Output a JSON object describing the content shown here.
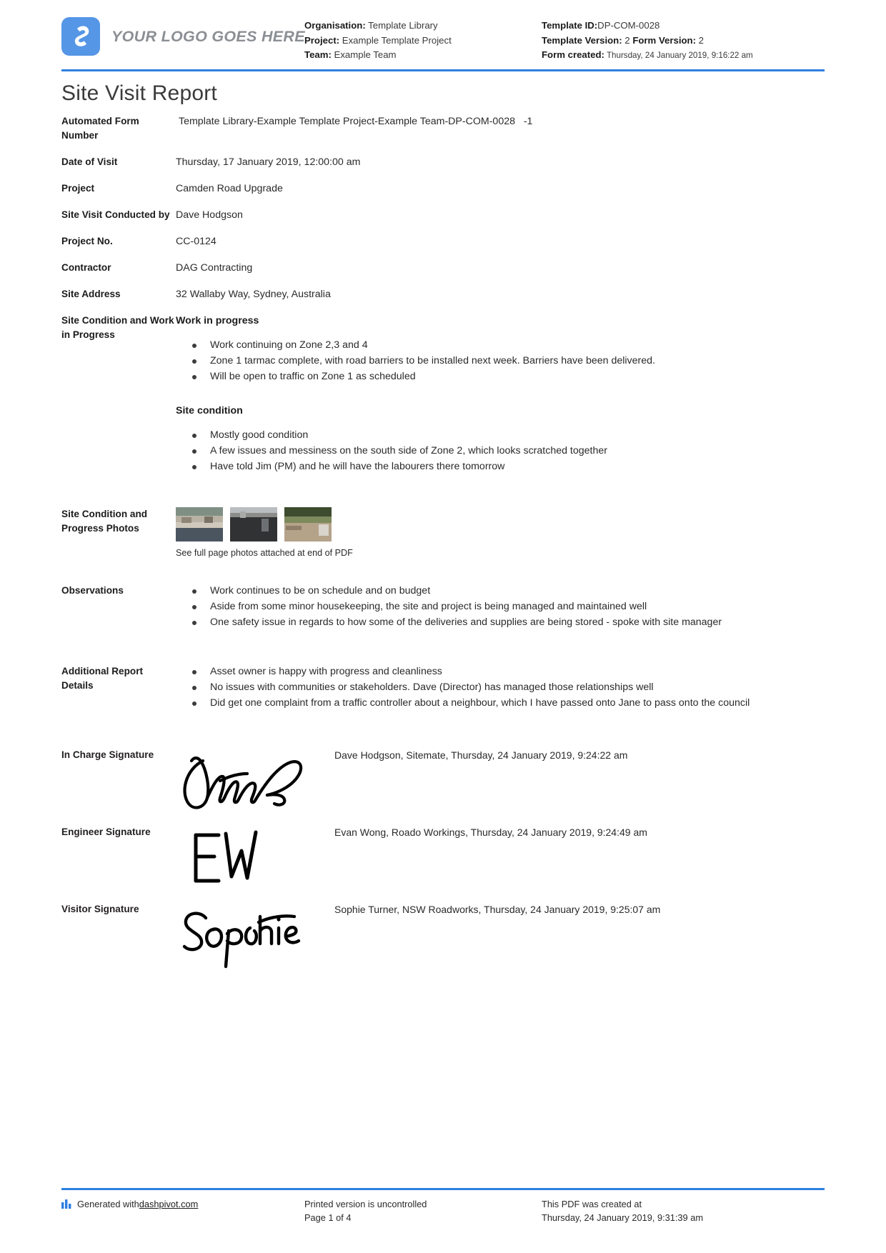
{
  "header": {
    "logo_text": "YOUR LOGO GOES HERE",
    "left": {
      "organisation_label": "Organisation:",
      "organisation_value": "Template Library",
      "project_label": "Project:",
      "project_value": "Example Template Project",
      "team_label": "Team:",
      "team_value": "Example Team"
    },
    "right": {
      "template_id_label": "Template ID:",
      "template_id_value": "DP-COM-0028",
      "template_version_label": "Template Version:",
      "template_version_value": "2",
      "form_version_label": "Form Version:",
      "form_version_value": "2",
      "form_created_label": "Form created:",
      "form_created_value": "Thursday, 24 January 2019, 9:16:22 am"
    }
  },
  "title": "Site Visit Report",
  "fields": {
    "automated_form_number_label": "Automated Form Number",
    "automated_form_number_value": "Template Library-Example Template Project-Example Team-DP-COM-0028   -1",
    "date_of_visit_label": "Date of Visit",
    "date_of_visit_value": "Thursday, 17 January 2019, 12:00:00 am",
    "project_label": "Project",
    "project_value": "Camden Road Upgrade",
    "conducted_by_label": "Site Visit Conducted by",
    "conducted_by_value": "Dave Hodgson",
    "project_no_label": "Project No.",
    "project_no_value": "CC-0124",
    "contractor_label": "Contractor",
    "contractor_value": "DAG Contracting",
    "site_address_label": "Site Address",
    "site_address_value": "32 Wallaby Way, Sydney, Australia",
    "site_condition_work_label": "Site Condition and Work in Progress",
    "photos_label": "Site Condition and Progress Photos",
    "photos_caption": "See full page photos attached at end of PDF",
    "observations_label": "Observations",
    "additional_details_label": "Additional Report Details"
  },
  "work_in_progress": {
    "heading": "Work in progress",
    "bullets": [
      "Work continuing on Zone 2,3 and 4",
      "Zone 1 tarmac complete, with road barriers to be installed next week. Barriers have been delivered.",
      "Will be open to traffic on Zone 1 as scheduled"
    ]
  },
  "site_condition": {
    "heading": "Site condition",
    "bullets": [
      "Mostly good condition",
      "A few issues and messiness on the south side of Zone 2, which looks scratched together",
      "Have told Jim (PM) and he will have the labourers there tomorrow"
    ]
  },
  "observations": {
    "bullets": [
      "Work continues to be on schedule and on budget",
      "Aside from some minor housekeeping, the site and project is being managed and maintained well",
      "One safety issue in regards to how some of the deliveries and supplies are being stored - spoke with site manager"
    ]
  },
  "additional_details": {
    "bullets": [
      "Asset owner is happy with progress and cleanliness",
      "No issues with communities or stakeholders. Dave (Director) has managed those relationships well",
      "Did get one complaint from a traffic controller about a neighbour, which I have passed onto Jane to pass onto the council"
    ]
  },
  "signatures": [
    {
      "label": "In Charge Signature",
      "meta": "Dave Hodgson, Sitemate, Thursday, 24 January 2019, 9:24:22 am",
      "glyph": "camm-signature"
    },
    {
      "label": "Engineer Signature",
      "meta": "Evan Wong, Roado Workings, Thursday, 24 January 2019, 9:24:49 am",
      "glyph": "ew-signature"
    },
    {
      "label": "Visitor Signature",
      "meta": "Sophie Turner, NSW Roadworks, Thursday, 24 January 2019, 9:25:07 am",
      "glyph": "sophie-signature"
    }
  ],
  "footer": {
    "generated_prefix": "Generated with ",
    "generated_link": "dashpivot.com",
    "printed_line1": "Printed version is uncontrolled",
    "printed_line2": "Page 1 of 4",
    "created_line1": "This PDF was created at",
    "created_line2": "Thursday, 24 January 2019, 9:31:39 am"
  },
  "colors": {
    "accent": "#2f7fe0",
    "logo_blue": "#5596e6",
    "logo_gray": "#8b8f94"
  }
}
